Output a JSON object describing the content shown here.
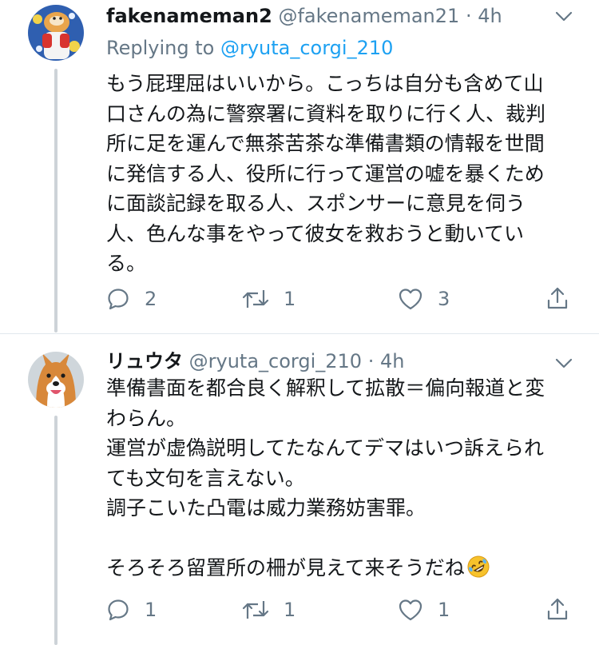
{
  "tweets": [
    {
      "display_name": "fakenameman2",
      "handle": "@fakenameman21",
      "separator": "·",
      "time": "4h",
      "replying_prefix": "Replying to",
      "replying_to": "@ryuta_corgi_210",
      "lines": [
        "もう屁理屈はいいから。こっちは自分も含めて山",
        "口さんの為に警察署に資料を取りに行く人、裁判",
        "所に足を運んで無茶苦茶な準備書類の情報を世間",
        "に発信する人、役所に行って運営の嘘を暴くため",
        "に面談記録を取る人、スポンサーに意見を伺う",
        "人、色んな事をやって彼女を救おうと動いてい",
        "る。"
      ],
      "replies": "2",
      "retweets": "1",
      "likes": "3"
    },
    {
      "display_name": "リュウタ",
      "handle": "@ryuta_corgi_210",
      "separator": "·",
      "time": "4h",
      "lines": [
        "準備書面を都合良く解釈して拡散＝偏向報道と変",
        "わらん。",
        "運営が虚偽説明してたなんてデマはいつ訴えられ",
        "ても文句を言えない。",
        "調子こいた凸電は威力業務妨害罪。",
        "",
        "そろそろ留置所の柵が見えて来そうだね"
      ],
      "emoji_icon": "rolling-on-floor-laughing-emoji",
      "replies": "1",
      "retweets": "1",
      "likes": "1"
    }
  ],
  "colors": {
    "text": "#14171a",
    "secondary": "#657786",
    "link": "#1da1f2",
    "thread_line": "#cdd3d8",
    "divider": "#e1e8ed"
  },
  "icons": [
    "reply-icon",
    "retweet-icon",
    "like-icon",
    "share-icon",
    "chevron-down-icon"
  ]
}
